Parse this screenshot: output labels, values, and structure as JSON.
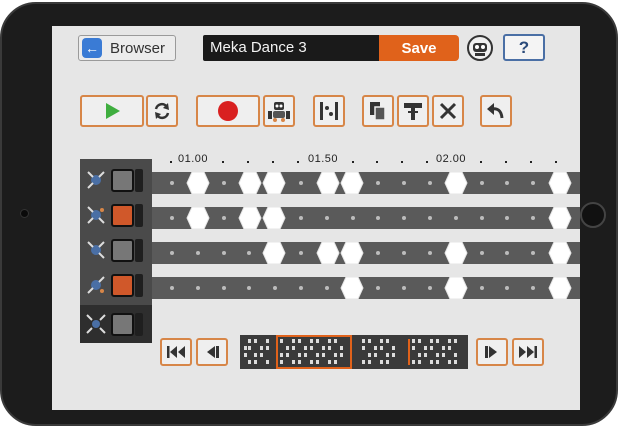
{
  "header": {
    "browser_label": "Browser",
    "title_value": "Meka Dance 3",
    "save_label": "Save",
    "help_label": "?"
  },
  "ruler": {
    "labels": [
      "01.00",
      "01.50",
      "02.00"
    ]
  },
  "colors": {
    "accent": "#e0621b",
    "button_border": "#d78648",
    "play_green": "#3fae3f",
    "record_red": "#d92020",
    "lane_gray": "#5a5a5a",
    "track_gray": "#777777",
    "track_orange": "#d0582a"
  },
  "tracks": [
    {
      "color": "gray",
      "motor_icon": "motor-icon"
    },
    {
      "color": "orange",
      "motor_icon": "motor-icon"
    },
    {
      "color": "gray",
      "motor_icon": "motor-icon"
    },
    {
      "color": "orange",
      "motor_icon": "motor-icon"
    },
    {
      "color": "gray",
      "motor_icon": "motor-group-icon"
    }
  ],
  "toolbar_icons": [
    "play-icon",
    "loop-icon",
    "record-icon",
    "robot-icon",
    "keyframe-icon",
    "copy-icon",
    "paste-icon",
    "delete-icon",
    "undo-icon"
  ],
  "nav_icons": [
    "skip-to-start-icon",
    "step-back-icon",
    "step-forward-icon",
    "skip-to-end-icon"
  ]
}
